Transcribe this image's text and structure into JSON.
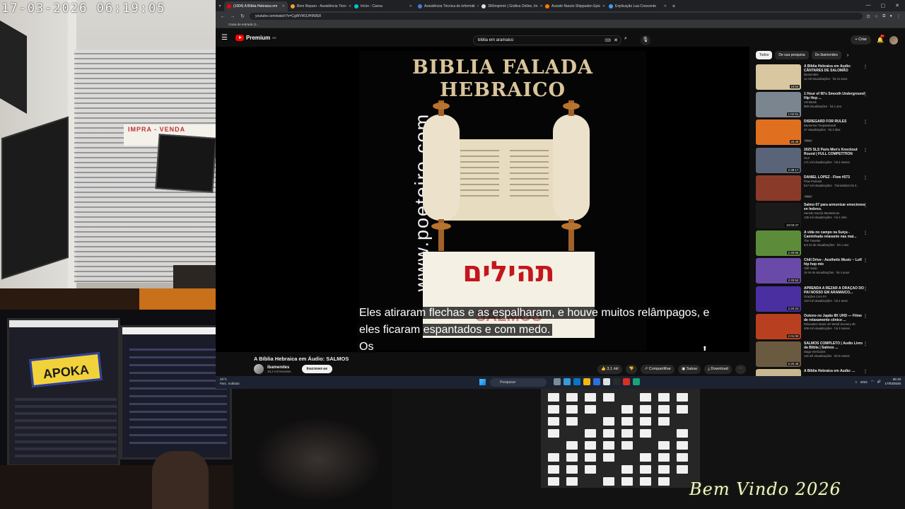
{
  "overlay": {
    "camera_timestamp": "17-03-2026 06:19:05",
    "shop_sign": "IMPRA - VENDA",
    "banner": "Bem Vindo 2026",
    "stream_logo": "APOKA"
  },
  "browser": {
    "tabs": [
      {
        "label": "(1004) A Bíblia Hebraica em",
        "active": true,
        "color": "#ff0000"
      },
      {
        "label": "Bom Reparo - Assistência Técn",
        "active": false,
        "color": "#f0a030"
      },
      {
        "label": "Início - Canva",
        "active": false,
        "color": "#00c4cc"
      },
      {
        "label": "Assistência Técnica de informáti",
        "active": false,
        "color": "#4a7bd8"
      },
      {
        "label": "360imprimir | Gráfica Online, Im",
        "active": false,
        "color": "#e0e0e0"
      },
      {
        "label": "Assistir Naruto Shippuden Epis",
        "active": false,
        "color": "#ff7a00"
      },
      {
        "label": "Explicação Lua Crescente",
        "active": false,
        "color": "#3aa0ff"
      }
    ],
    "url": "youtube.com/watch?v=CgWVW3JH9WE8",
    "bookmark": "Caixa de entrada (1..."
  },
  "youtube": {
    "logo": "Premium",
    "logo_region": "BR",
    "search_value": "biblia em aramaico",
    "create_label": "Criar",
    "notifications_badge": "9+",
    "video": {
      "cover_line1": "BIBLIA FALADA",
      "cover_line2": "HEBRAICO",
      "cover_site": "www.poeteiro.com",
      "cover_hebrew": "תהילים",
      "cover_salmos": "SALMOS",
      "subtitle_line1": "Eles atiraram flechas e as espalharam, e houve muitos relâmpagos, e",
      "subtitle_line2": "eles ficaram espantados e com medo.",
      "subtitle_line3": "Os"
    },
    "title": "A Bíblia Hebraica em Áudio: SALMOS",
    "channel": "ibamendes",
    "subscribers": "10,2 mil inscritos",
    "subscribe_label": "Inscrever-se",
    "likes": "3,1 mil",
    "share_label": "Compartilhar",
    "save_label": "Salvar",
    "download_label": "Download",
    "chips": [
      "Todos",
      "De sua pesquisa",
      "De ibamendes"
    ],
    "recommendations": [
      {
        "title": "A Bíblia Hebraica em Áudio: CÂNTARES DE SALOMÃO",
        "channel": "ibamendes",
        "views": "11 mil visualizações · há 12 anos",
        "duration": "19:54",
        "thumb": "#d8c7a0",
        "badge": ""
      },
      {
        "title": "1 Hour of 90's Smooth Underground Hip Hop ...",
        "channel": "Vin Beats",
        "views": "969 visualizações · há 1 ano",
        "duration": "1:02:51",
        "thumb": "#7b8590",
        "badge": ""
      },
      {
        "title": "DISREGARD FOR RULES",
        "channel": "Валентин Тхоржевский",
        "views": "47 visualizações · há 3 dias",
        "duration": "25:48",
        "thumb": "#e07020",
        "badge": "Novo"
      },
      {
        "title": "2025 SLS Paris Men's Knockout Round | FULL COMPETITION",
        "channel": "SLS",
        "views": "171 mil visualizações · há 4 meses",
        "duration": "2:38:17",
        "thumb": "#5a6478",
        "badge": ""
      },
      {
        "title": "DANIEL LOPEZ - Flow #573",
        "channel": "Flow Podcast",
        "views": "517 mil visualizações · Transmitido há 3...",
        "duration": "",
        "thumb": "#8a3a28",
        "badge": "Novo"
      },
      {
        "title": "Salmo 67 para armonizar emociones en hebreo.",
        "channel": "Hernán García Montesinos",
        "views": "136 mil visualizações · há 1 mês",
        "duration": "10:03:47",
        "thumb": "#1a1a1a",
        "badge": ""
      },
      {
        "title": "A vida no campo na Suíça - Caminhada relaxante nas mai...",
        "channel": "The Traveler",
        "views": "8,5 mi de visualizações · há 1 ano",
        "duration": "2:49:55",
        "thumb": "#5c8c3a",
        "badge": ""
      },
      {
        "title": "Chill Drive - Aesthetic Music ~ Lofi hip hop mix",
        "channel": "chill music",
        "views": "16 mi de visualizações · há 4 anos",
        "duration": "2:33:52",
        "thumb": "#6a4aa8",
        "badge": ""
      },
      {
        "title": "APRENDA A REZAR A ORAÇÃO DO PAI NOSSO EM ARAMAICO...",
        "channel": "Orações Com Fé",
        "views": "122 mil visualizações · há 4 anos",
        "duration": "2:20:23",
        "thumb": "#4a2fa0",
        "badge": ""
      },
      {
        "title": "Outono no Japão 8K UHD — Filme de relaxamento cênico ...",
        "channel": "Relaxation Music 4K World Scenery 4K",
        "views": "406 mil visualizações · há 3 meses",
        "duration": "2:01:00",
        "thumb": "#b84020",
        "badge": ""
      },
      {
        "title": "SALMOS COMPLETO | Áudio Livro da Bíblia | Salmos ...",
        "channel": "Daga Versículos",
        "views": "116 mil visualizações · há 6 meses",
        "duration": "5:25:48",
        "thumb": "#6a5a40",
        "badge": ""
      },
      {
        "title": "A Bíblia Hebraica em Áudio: ...",
        "channel": "",
        "views": "",
        "duration": "",
        "thumb": "#c8b890",
        "badge": ""
      }
    ]
  },
  "taskbar": {
    "temperature": "25°C",
    "weather": "Parc. nublado",
    "search_placeholder": "Pesquisar",
    "language": "ENG",
    "time": "06:19",
    "date": "17/03/2026"
  }
}
